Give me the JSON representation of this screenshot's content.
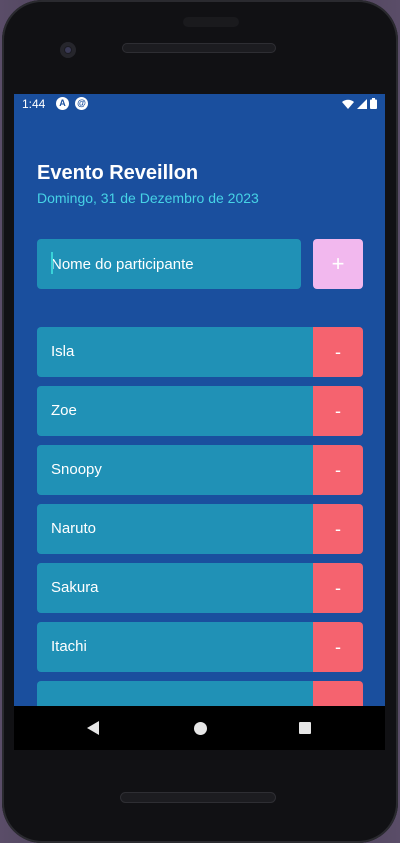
{
  "status_bar": {
    "time": "1:44",
    "icons": [
      "a-icon",
      "sync-icon",
      "wifi-icon",
      "signal-icon",
      "battery-icon"
    ]
  },
  "app": {
    "title": "Evento Reveillon",
    "date": "Domingo, 31 de Dezembro de 2023"
  },
  "form": {
    "input_placeholder": "Nome do participante",
    "add_label": "+"
  },
  "participants": [
    {
      "name": "Isla",
      "remove_label": "-"
    },
    {
      "name": "Zoe",
      "remove_label": "-"
    },
    {
      "name": "Snoopy",
      "remove_label": "-"
    },
    {
      "name": "Naruto",
      "remove_label": "-"
    },
    {
      "name": "Sakura",
      "remove_label": "-"
    },
    {
      "name": "Itachi",
      "remove_label": "-"
    },
    {
      "name": "",
      "remove_label": "-"
    }
  ],
  "colors": {
    "background": "#1a4f9e",
    "accent_date": "#46d3e6",
    "input_bg": "#2091b6",
    "add_button": "#f2b8ee",
    "remove_button": "#f5636f"
  }
}
